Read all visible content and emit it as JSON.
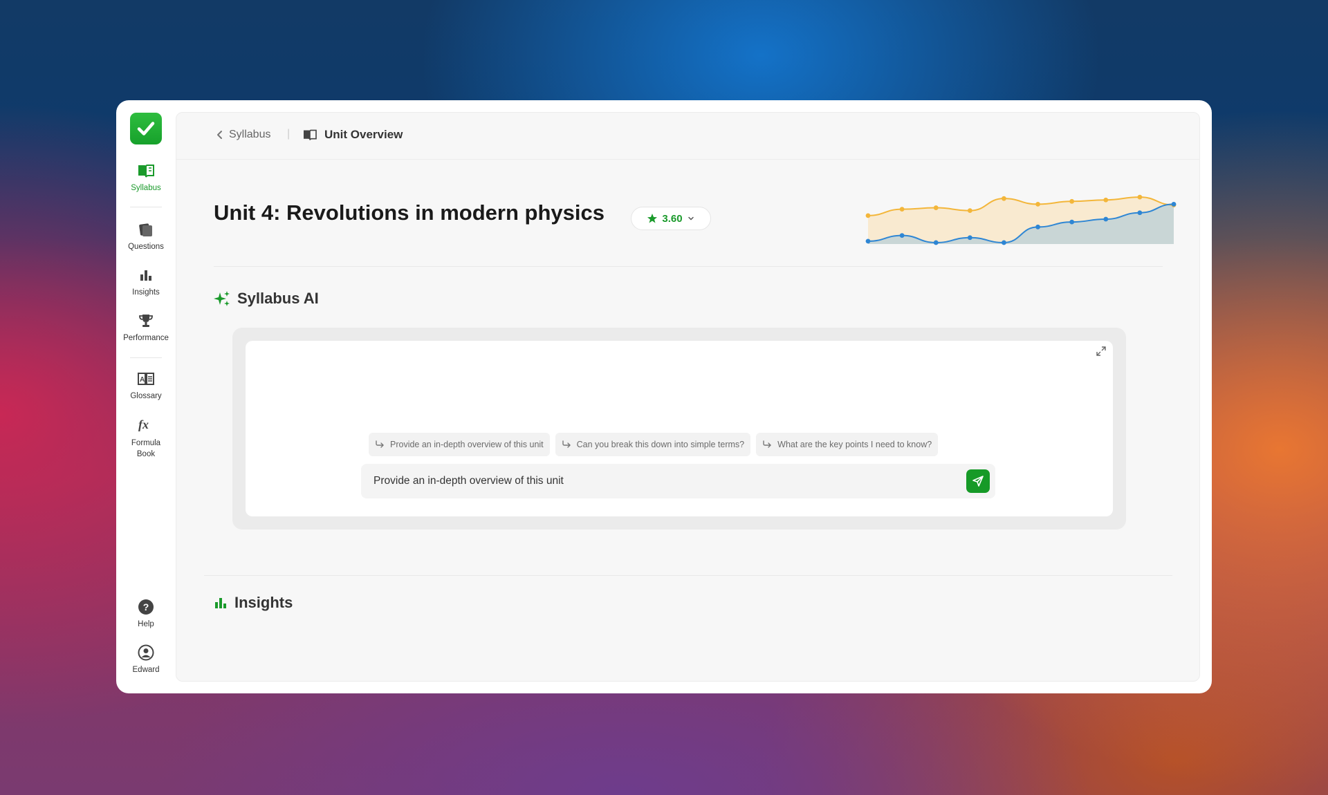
{
  "sidebar": {
    "items": [
      {
        "label": "Syllabus",
        "icon": "book-open-icon"
      },
      {
        "label": "Questions",
        "icon": "cards-icon"
      },
      {
        "label": "Insights",
        "icon": "bar-chart-icon"
      },
      {
        "label": "Performance",
        "icon": "trophy-icon"
      },
      {
        "label": "Glossary",
        "icon": "dictionary-icon"
      },
      {
        "label": "Formula Book",
        "icon": "fx-icon"
      }
    ],
    "bottom": [
      {
        "label": "Help",
        "icon": "help-icon"
      },
      {
        "label": "Edward",
        "icon": "user-icon"
      }
    ]
  },
  "breadcrumb": {
    "back_label": "Syllabus",
    "current_label": "Unit Overview"
  },
  "unit": {
    "title": "Unit 4: Revolutions in modern physics",
    "rating": "3.60"
  },
  "ai": {
    "title": "Syllabus AI",
    "suggestions": [
      "Provide an in-depth overview of this unit",
      "Can you break this down into simple terms?",
      "What are the key points I need to know?"
    ],
    "input_value": "Provide an in-depth overview of this unit"
  },
  "insights": {
    "title": "Insights"
  },
  "colors": {
    "accent": "#1a9a2b",
    "orange_series": "#f3b63a",
    "blue_series": "#2e86d4"
  },
  "chart_data": {
    "type": "area",
    "x": [
      1,
      2,
      3,
      4,
      5,
      6,
      7,
      8,
      9,
      10
    ],
    "series": [
      {
        "values": [
          40,
          49,
          51,
          47,
          64,
          56,
          60,
          62,
          66,
          55
        ]
      },
      {
        "values": [
          4,
          12,
          2,
          9,
          2,
          24,
          31,
          35,
          44,
          56
        ]
      }
    ],
    "ylim": [
      0,
      70
    ],
    "grid": false
  }
}
